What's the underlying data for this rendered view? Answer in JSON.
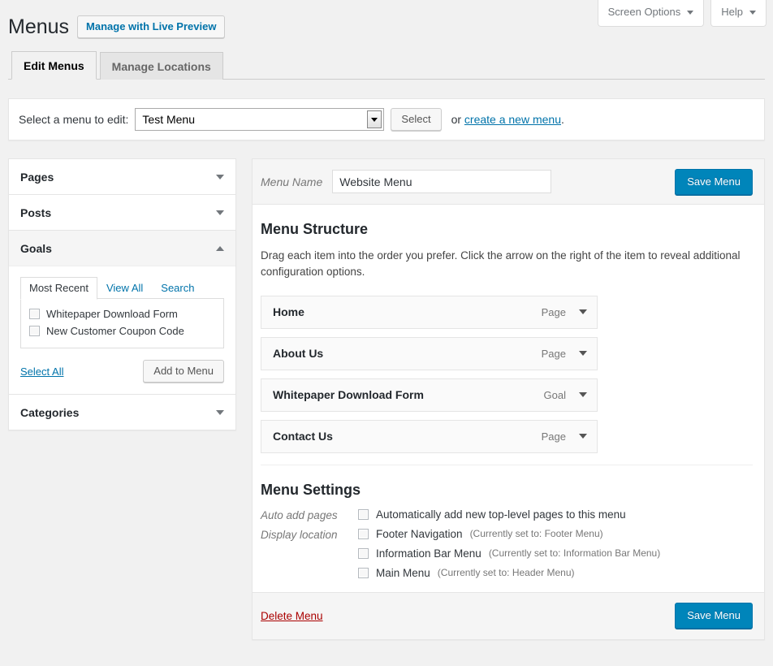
{
  "topbar": {
    "screen_options": "Screen Options",
    "help": "Help"
  },
  "header": {
    "title": "Menus",
    "live_preview_button": "Manage with Live Preview"
  },
  "tabs": [
    {
      "label": "Edit Menus",
      "active": true
    },
    {
      "label": "Manage Locations",
      "active": false
    }
  ],
  "select_bar": {
    "label": "Select a menu to edit:",
    "selected_menu": "Test Menu",
    "select_button": "Select",
    "or_text": "or",
    "create_link": "create a new menu",
    "period": "."
  },
  "sidebar": {
    "panels": [
      {
        "title": "Pages",
        "open": false
      },
      {
        "title": "Posts",
        "open": false
      },
      {
        "title": "Goals",
        "open": true
      },
      {
        "title": "Categories",
        "open": false
      }
    ],
    "goals": {
      "tabs": [
        {
          "label": "Most Recent",
          "active": true
        },
        {
          "label": "View All",
          "active": false
        },
        {
          "label": "Search",
          "active": false
        }
      ],
      "items": [
        {
          "label": "Whitepaper Download Form",
          "checked": false
        },
        {
          "label": "New Customer Coupon Code",
          "checked": false
        }
      ],
      "select_all": "Select All",
      "add_to_menu": "Add to Menu"
    }
  },
  "main": {
    "menu_name_label": "Menu Name",
    "menu_name_value": "Website Menu",
    "save_menu_top": "Save Menu",
    "structure_heading": "Menu Structure",
    "structure_description": "Drag each item into the order you prefer. Click the arrow on the right of the item to reveal additional configuration options.",
    "items": [
      {
        "title": "Home",
        "type": "Page"
      },
      {
        "title": "About Us",
        "type": "Page"
      },
      {
        "title": "Whitepaper Download Form",
        "type": "Goal"
      },
      {
        "title": "Contact Us",
        "type": "Page"
      }
    ],
    "settings_heading": "Menu Settings",
    "auto_add_label": "Auto add pages",
    "auto_add_option": "Automatically add new top-level pages to this menu",
    "display_location_label": "Display location",
    "locations": [
      {
        "label": "Footer Navigation",
        "hint": "(Currently set to: Footer Menu)",
        "checked": false
      },
      {
        "label": "Information Bar Menu",
        "hint": "(Currently set to: Information Bar Menu)",
        "checked": false
      },
      {
        "label": "Main Menu",
        "hint": "(Currently set to: Header Menu)",
        "checked": false
      }
    ],
    "delete_menu": "Delete Menu",
    "save_menu_bottom": "Save Menu"
  },
  "colors": {
    "accent": "#0073aa",
    "primary_button": "#0085ba",
    "delete_link": "#a00",
    "page_background": "#f1f1f1"
  }
}
